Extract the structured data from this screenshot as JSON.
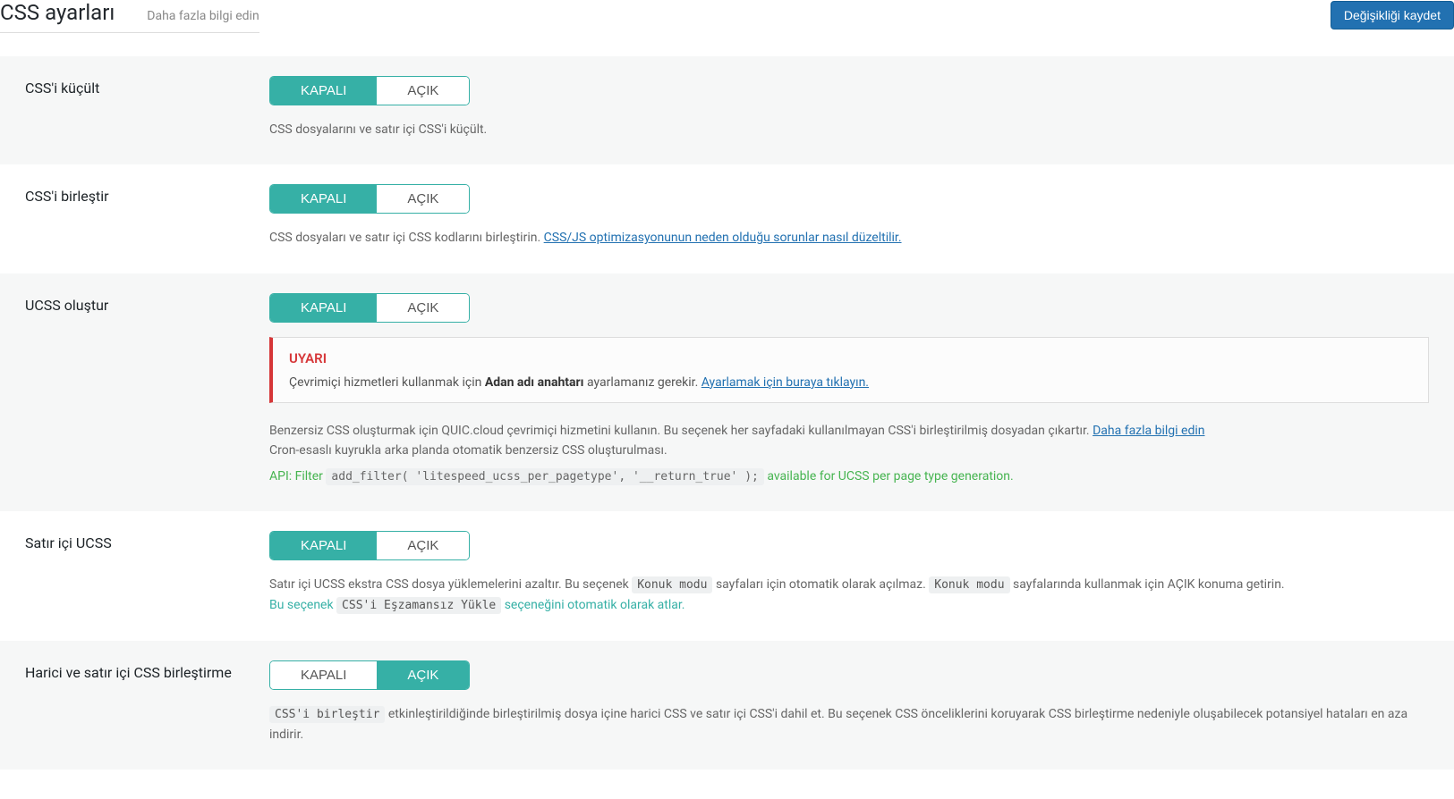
{
  "header": {
    "title": "CSS ayarları",
    "learn_more": "Daha fazla bilgi edin",
    "save_button": "Değişikliği kaydet"
  },
  "toggle": {
    "off": "KAPALI",
    "on": "AÇIK"
  },
  "rows": {
    "minify": {
      "label": "CSS'i küçült",
      "desc": "CSS dosyalarını ve satır içi CSS'i küçült."
    },
    "combine": {
      "label": "CSS'i birleştir",
      "desc_prefix": "CSS dosyaları ve satır içi CSS kodlarını birleştirin. ",
      "desc_link": "CSS/JS optimizasyonunun neden olduğu sorunlar nasıl düzeltilir."
    },
    "ucss": {
      "label": "UCSS oluştur",
      "notice_title": "UYARI",
      "notice_prefix": "Çevrimiçi hizmetleri kullanmak için ",
      "notice_bold": "Adan adı anahtarı",
      "notice_mid": " ayarlamanız gerekir. ",
      "notice_link": "Ayarlamak için buraya tıklayın.",
      "desc1_prefix": "Benzersiz CSS oluşturmak için QUIC.cloud çevrimiçi hizmetini kullanın. Bu seçenek her sayfadaki kullanılmayan CSS'i birleştirilmiş dosyadan çıkartır. ",
      "desc1_link": "Daha fazla bilgi edin",
      "desc2": "Cron-esaslı kuyrukla arka planda otomatik benzersiz CSS oluşturulması.",
      "api_label": "API: Filter",
      "api_code": "add_filter( 'litespeed_ucss_per_pagetype', '__return_true' );",
      "api_tail": "available for UCSS per page type generation."
    },
    "inline_ucss": {
      "label": "Satır içi UCSS",
      "desc_p1": "Satır içi UCSS ekstra CSS dosya yüklemelerini azaltır. Bu seçenek ",
      "badge1": "Konuk modu",
      "desc_p2": " sayfaları için otomatik olarak açılmaz. ",
      "badge2": "Konuk modu",
      "desc_p3": " sayfalarında kullanmak için AÇIK konuma getirin.",
      "teal_p1": "Bu seçenek ",
      "teal_badge": "CSS'i Eşzamansız Yükle",
      "teal_p2": " seçeneğini otomatik olarak atlar."
    },
    "ext_inline": {
      "label": "Harici ve satır içi CSS birleştirme",
      "badge": "CSS'i birleştir",
      "desc": " etkinleştirildiğinde birleştirilmiş dosya içine harici CSS ve satır içi CSS'i dahil et. Bu seçenek CSS önceliklerini koruyarak CSS birleştirme nedeniyle oluşabilecek potansiyel hataları en aza indirir."
    }
  }
}
